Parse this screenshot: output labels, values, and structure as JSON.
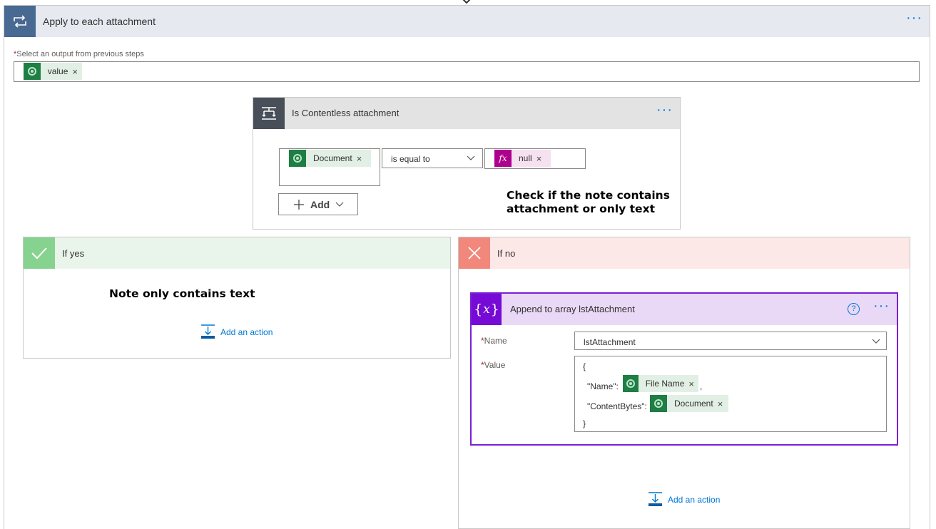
{
  "loop": {
    "title": "Apply to each attachment",
    "select_label": "Select an output from previous steps",
    "token_label": "value"
  },
  "condition": {
    "title": "Is Contentless attachment",
    "left_token": "Document",
    "operator": "is equal to",
    "right_token": "null",
    "add_label": "Add",
    "annotation_line1": "Check if the note contains",
    "annotation_line2": "attachment or only text"
  },
  "yes_branch": {
    "title": "If yes",
    "annotation": "Note only contains text",
    "add_action": "Add an action"
  },
  "no_branch": {
    "title": "If no",
    "add_action": "Add an action",
    "append": {
      "title": "Append to array lstAttachment",
      "name_label": "Name",
      "name_value": "lstAttachment",
      "value_label": "Value",
      "open_brace": "{",
      "name_key": "\"Name\":",
      "name_token": "File Name",
      "comma": ",",
      "content_key": "\"ContentBytes\":",
      "content_token": "Document",
      "close_brace": "}"
    }
  },
  "colors": {
    "loop_header": "#e6e9f0",
    "loop_icon": "#486991",
    "condition_icon": "#484f58",
    "yes_header": "#e9f5ea",
    "yes_icon": "#86d28f",
    "no_header": "#fde8e8",
    "no_icon": "#f2877c",
    "append_border": "#7a1fd6",
    "append_header": "#ead9f6",
    "variable_icon": "#770bd6",
    "expression_icon": "#ad008c",
    "dataverse_icon": "#1e7e44",
    "link": "#0078d4"
  }
}
